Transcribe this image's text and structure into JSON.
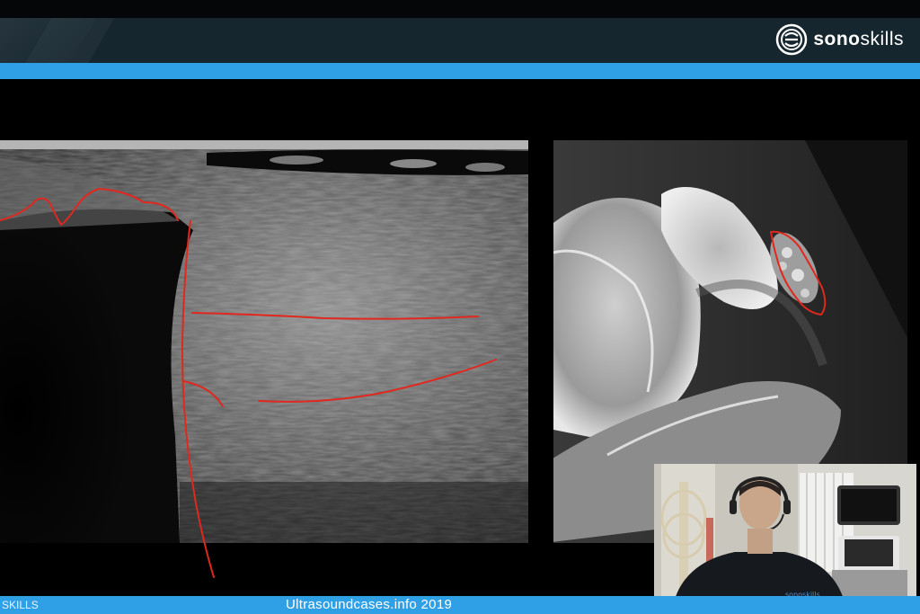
{
  "header": {
    "brand_bold": "sono",
    "brand_rest": "skills",
    "logo_icon": "sonoskills-logo-icon"
  },
  "footer": {
    "brand": "SKILLS",
    "caption": "Ultrasoundcases.info 2019"
  },
  "colors": {
    "header_bg": "#16262f",
    "accent": "#2f9fe6",
    "annotation": "#e0281e"
  },
  "webcam": {
    "badge": "sonoskills"
  }
}
